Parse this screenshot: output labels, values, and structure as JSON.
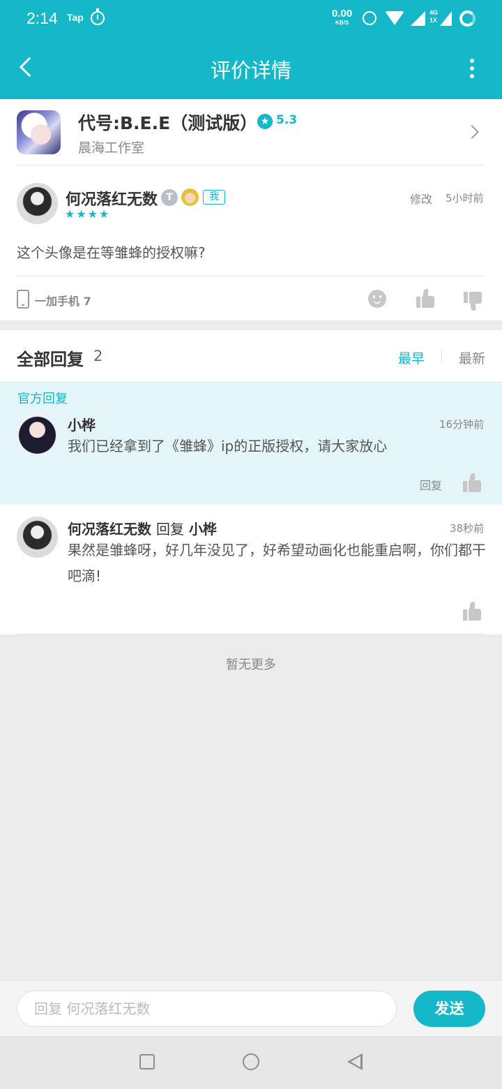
{
  "status_bar": {
    "time": "2:14",
    "tap_label": "Tap",
    "net_speed_value": "0.00",
    "net_speed_unit": "KB/S",
    "network_type": "4G",
    "network_sub": "1X"
  },
  "header": {
    "title": "评价详情",
    "icons": [
      "back-arrow-icon",
      "more-vertical-icon"
    ]
  },
  "app": {
    "name": "代号:B.E.E（测试版）",
    "rating": "5.3",
    "developer": "晨海工作室"
  },
  "review": {
    "user_name": "何况落红无数",
    "badge_t": "T",
    "me_badge": "我",
    "stars": "★★★★",
    "star_count": 4,
    "edit_label": "修改",
    "time": "5小时前",
    "text": "这个头像是在等雏蜂的授权嘛?",
    "device": "一加手机 7"
  },
  "replies": {
    "title": "全部回复",
    "count": "2",
    "sort_earliest": "最早",
    "sort_newest": "最新",
    "official_label": "官方回复",
    "items": [
      {
        "name": "小桦",
        "time": "16分钟前",
        "text": "我们已经拿到了《雏蜂》ip的正版授权，请大家放心",
        "reply_label": "回复"
      },
      {
        "name": "何况落红无数",
        "reply_word": "回复",
        "reply_to": "小桦",
        "time": "38秒前",
        "text": "果然是雏蜂呀，好几年没见了，好希望动画化也能重启啊，你们都干吧滴!"
      }
    ],
    "end_text": "暂无更多"
  },
  "input_bar": {
    "placeholder": "回复 何况落红无数",
    "send_label": "发送"
  },
  "colors": {
    "accent": "#15b8c9",
    "official_bg": "#e3f5f8",
    "page_bg": "#ebebeb"
  }
}
